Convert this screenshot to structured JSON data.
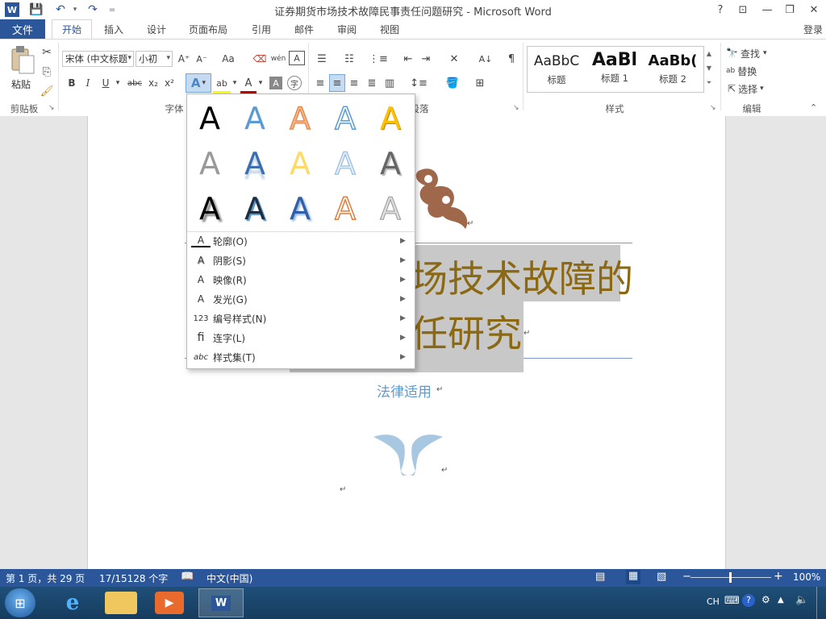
{
  "window": {
    "title": "证券期货市场技术故障民事责任问题研究 - Microsoft Word",
    "controls": [
      "?",
      "⊡",
      "—",
      "❐",
      "✕"
    ]
  },
  "qat": {
    "save": "💾",
    "undo": "↶",
    "redo": "↷",
    "customize": "="
  },
  "tabs": {
    "file": "文件",
    "items": [
      "开始",
      "插入",
      "设计",
      "页面布局",
      "引用",
      "邮件",
      "审阅",
      "视图"
    ],
    "login": "登录"
  },
  "ribbon": {
    "clipboard": {
      "paste": "粘贴",
      "label": "剪贴板"
    },
    "font": {
      "name": "宋体 (中文标题",
      "size": "小初",
      "label": "字体",
      "grow": "A⁺",
      "shrink": "A⁻",
      "case": "Aa",
      "clear": "⌫",
      "phonetic": "wén",
      "border": "A",
      "bold": "B",
      "italic": "I",
      "underline": "U",
      "strike": "abc",
      "sub": "x₂",
      "sup": "x²",
      "effects": "A",
      "highlight": "ab",
      "color": "A",
      "shade": "A",
      "enclose": "字"
    },
    "paragraph": {
      "label": "段落"
    },
    "styles": {
      "label": "样式",
      "items": [
        {
          "preview": "AaBbC",
          "name": "标题"
        },
        {
          "preview": "AaBl",
          "name": "标题 1"
        },
        {
          "preview": "AaBb(",
          "name": "标题 2"
        }
      ]
    },
    "editing": {
      "label": "编辑",
      "find": "查找",
      "replace": "替换",
      "select": "选择"
    }
  },
  "dropdown": {
    "gallery_glyph": "A",
    "menu": [
      {
        "icon": "A",
        "label": "轮廓(O)"
      },
      {
        "icon": "A",
        "label": "阴影(S)"
      },
      {
        "icon": "A",
        "label": "映像(R)"
      },
      {
        "icon": "A",
        "label": "发光(G)"
      },
      {
        "icon": "123",
        "label": "编号样式(N)"
      },
      {
        "icon": "fi",
        "label": "连字(L)"
      },
      {
        "icon": "abc",
        "label": "样式集(T)"
      }
    ]
  },
  "document": {
    "title_line1": "场技术故障的",
    "title_line2": "任研究",
    "subtitle": "法律适用"
  },
  "status": {
    "page": "第 1 页，共 29 页",
    "words": "17/15128 个字",
    "language": "中文(中国)",
    "zoom": "100%"
  },
  "taskbar": {
    "ime": "CH"
  },
  "colors": {
    "accent": "#2b579a",
    "title_text": "#8b6914",
    "subtitle_text": "#5b9bd5",
    "highlight": "#c8c8c8"
  }
}
